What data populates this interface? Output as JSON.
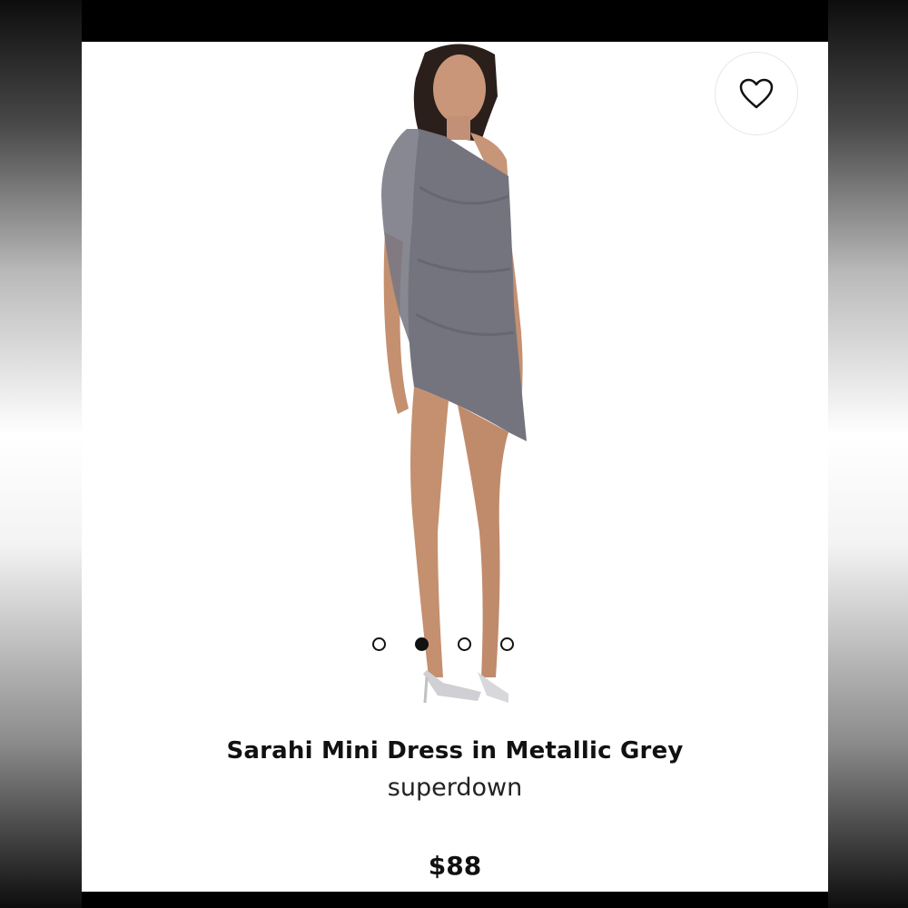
{
  "product": {
    "title": "Sarahi Mini Dress in Metallic Grey",
    "brand": "superdown",
    "price": "$88",
    "image": {
      "description_icon": "model-photo"
    }
  },
  "favorite": {
    "icon": "heart-outline-icon"
  },
  "carousel": {
    "count": 4,
    "active_index": 1
  },
  "colors": {
    "dress": "#74747f",
    "accent": "#111111",
    "card_background": "#ffffff",
    "frame": "#000000"
  }
}
